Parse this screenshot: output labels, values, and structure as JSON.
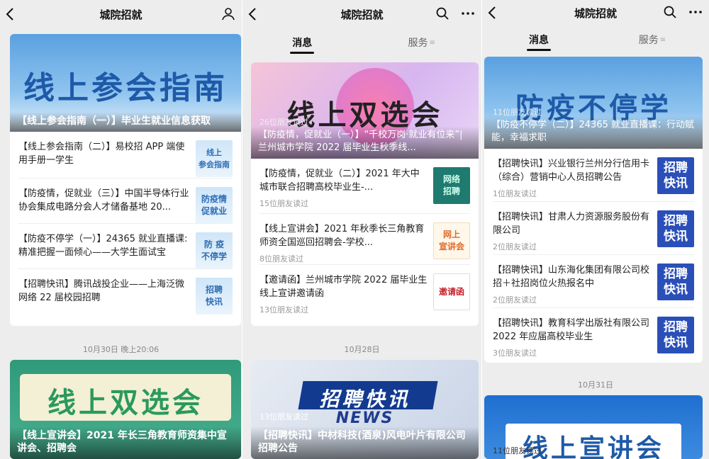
{
  "panels": [
    {
      "title": "城院招就",
      "hero": {
        "big": "线上参会指南",
        "caption": "【线上参会指南（一）】毕业生就业信息获取"
      },
      "items": [
        {
          "text": "【线上参会指南（二）】易校招 APP 端使用手册一学生",
          "thumb": "线上\n参会指南"
        },
        {
          "text": "【防疫情，促就业（三）】中国半导体行业协会集成电路分会人才储备基地 20...",
          "thumb": "防疫情\n促就业"
        },
        {
          "text": "【防疫不停学（一）】24365 就业直播课:精准把握一面倾心——大学生面试宝",
          "thumb": "防 疫\n不停学"
        },
        {
          "text": "【招聘快讯】腾讯战投企业——上海泛微网络 22 届校园招聘",
          "thumb": "招聘\n快讯"
        }
      ],
      "date": "10月30日 晚上20:06",
      "second": {
        "big": "线上双选会",
        "caption": "【线上宣讲会】2021 年长三角教育师资集中宣讲会、招聘会"
      }
    },
    {
      "title": "城院招就",
      "tabs": [
        "消息",
        "服务"
      ],
      "hero": {
        "big": "线上双选会",
        "reads": "26位朋友读过",
        "caption": "【防疫情，促就业（一）】“千校万岗·就业有位来”| 兰州城市学院 2022 届毕业生秋季线..."
      },
      "items": [
        {
          "text": "【防疫情，促就业（二）】2021 年大中城市联合招聘高校毕业生-...",
          "sub": "15位朋友读过",
          "thumb": "网络\n招聘"
        },
        {
          "text": "【线上宣讲会】2021 年秋季长三角教育师资全国巡回招聘会-学校...",
          "sub": "8位朋友读过",
          "thumb": "网上\n宣讲会"
        },
        {
          "text": "【邀请函】兰州城市学院 2022 届毕业生线上宣讲邀请函",
          "sub": "13位朋友读过",
          "thumb": "邀请函"
        }
      ],
      "date": "10月28日",
      "second": {
        "big": "招聘快讯",
        "news": "NEWS",
        "reads": "13位朋友读过",
        "caption": "【招聘快讯】中材科技(酒泉)风电叶片有限公司招聘公告"
      }
    },
    {
      "title": "城院招就",
      "tabs": [
        "消息",
        "服务"
      ],
      "hero": {
        "big": "防疫不停学",
        "reads": "11位朋友读过",
        "caption": "【防疫不停学（二）】24365 就业直播课：行动赋能，幸福求职"
      },
      "items": [
        {
          "text": "【招聘快讯】兴业银行兰州分行信用卡（综合）营销中心人员招聘公告",
          "sub": "1位朋友读过",
          "thumb": "招聘\n快讯"
        },
        {
          "text": "【招聘快讯】甘肃人力资源服务股份有限公司",
          "sub": "2位朋友读过",
          "thumb": "招聘\n快讯"
        },
        {
          "text": "【招聘快讯】山东海化集团有限公司校招＋社招岗位火热报名中",
          "sub": "2位朋友读过",
          "thumb": "招聘\n快讯"
        },
        {
          "text": "【招聘快讯】教育科学出版社有限公司 2022 年应届高校毕业生",
          "sub": "3位朋友读过",
          "thumb": "招聘\n快讯"
        }
      ],
      "date": "10月31日",
      "second": {
        "big": "线上宣讲会",
        "reads": "11位朋友读过"
      }
    }
  ],
  "colors": {
    "accent": "#1e5aa8",
    "bg": "#ededed"
  }
}
